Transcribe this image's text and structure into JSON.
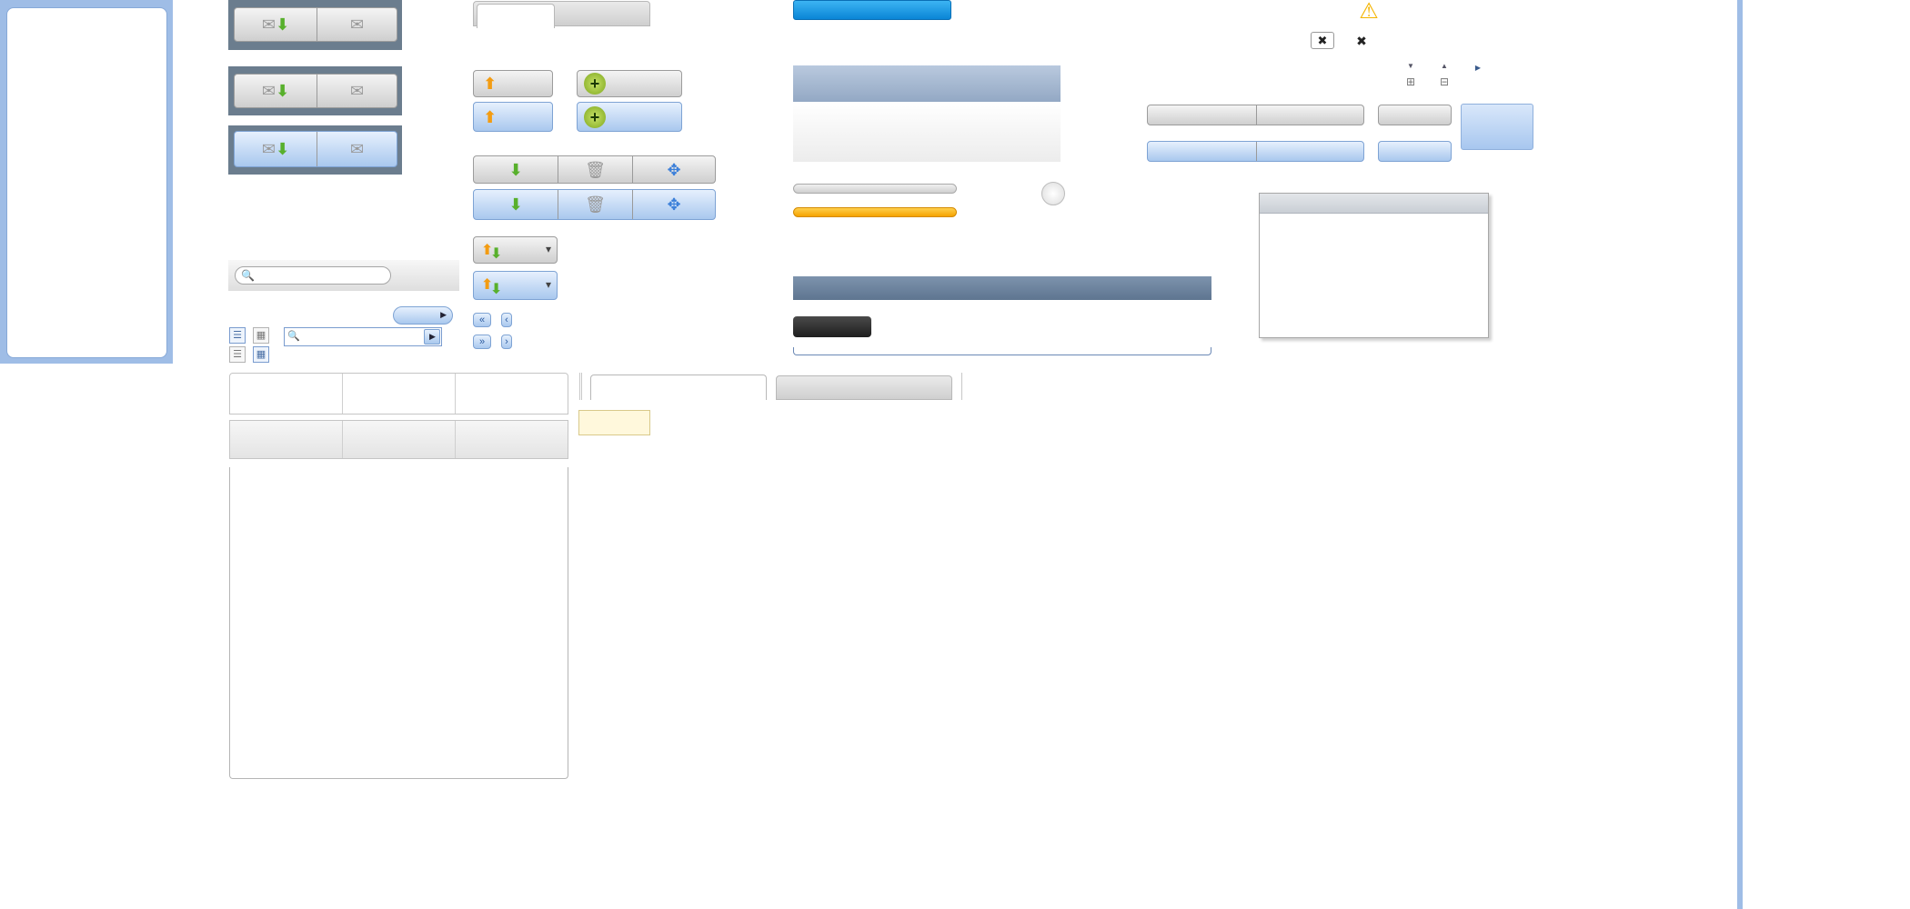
{
  "colors": {
    "frame_blue": "#9fbde6",
    "accent_blue": "#1b9be6",
    "orange": "#f5a300",
    "dark_button": "#2e2e2e",
    "warning": "#f4b400",
    "tooltip_bg": "#fff8dc"
  },
  "icons": {
    "down_arrow": "⬇",
    "up_arrow": "⬆",
    "mail": "✉",
    "plus": "+",
    "trash": "🗑",
    "move": "✥",
    "caret_down": "▾",
    "first": "«",
    "prev": "‹",
    "next": "›",
    "last": "»",
    "close": "✖",
    "warning": "⚠",
    "search": "🔍",
    "arrow_right": "▶",
    "tri_down": "▼",
    "tri_up": "▲",
    "tri_right": "▶",
    "expand": "⊞",
    "collapse": "⊟",
    "list_view": "☰",
    "grid_view": "▦"
  },
  "search_main": {
    "placeholder": ""
  },
  "search_small": {
    "placeholder": ""
  }
}
